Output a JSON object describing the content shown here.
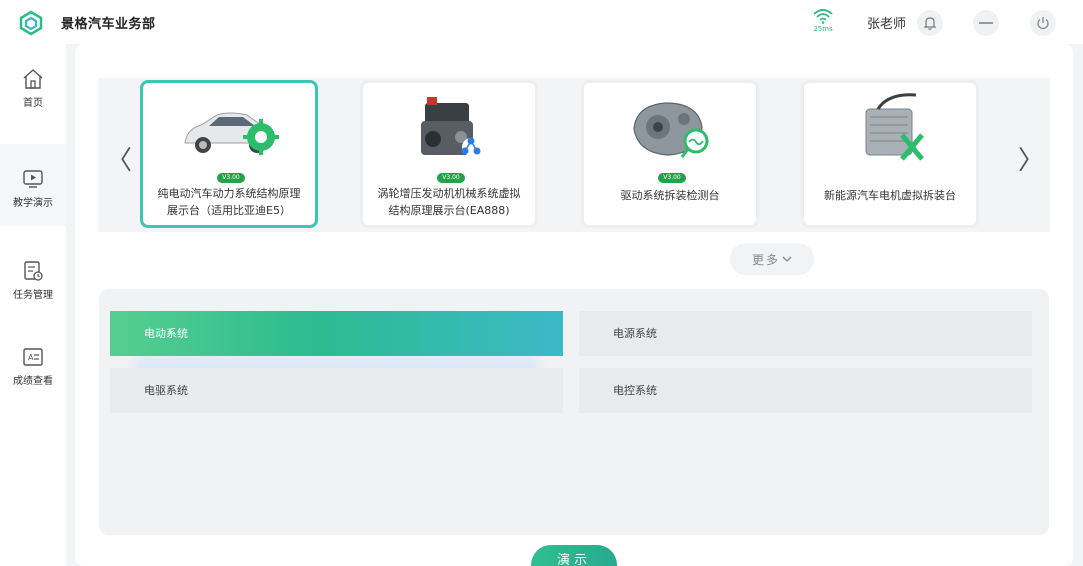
{
  "header": {
    "app_title": "景格汽车业务部",
    "latency": "25ms",
    "user_name": "张老师"
  },
  "icons": {
    "logo": "logo-icon",
    "wifi": "wifi-icon",
    "bell": "bell-icon",
    "more": "more-icon",
    "power": "power-icon"
  },
  "sidebar": {
    "items": [
      {
        "label": "首页",
        "icon": "home-icon"
      },
      {
        "label": "教学演示",
        "icon": "play-screen-icon"
      },
      {
        "label": "任务管理",
        "icon": "task-icon"
      },
      {
        "label": "成绩查看",
        "icon": "score-icon"
      }
    ]
  },
  "carousel": {
    "prev": "〈",
    "next": "〉",
    "cards": [
      {
        "version": "V3.00",
        "title": "纯电动汽车动力系统结构原理展示台（适用比亚迪E5）"
      },
      {
        "version": "V3.00",
        "title": "涡轮增压发动机机械系统虚拟结构原理展示台(EA888)"
      },
      {
        "version": "V3.00",
        "title": "驱动系统拆装检测台"
      },
      {
        "version": "",
        "title": "新能源汽车电机虚拟拆装台"
      }
    ]
  },
  "more_label": "更多",
  "systems": [
    {
      "label": "电动系统"
    },
    {
      "label": "电源系统"
    },
    {
      "label": "电驱系统"
    },
    {
      "label": "电控系统"
    }
  ],
  "demo_label": "演示",
  "colors": {
    "accent": "#2bbd84",
    "selected_border": "#3cc5b3",
    "version_badge": "#22a34a"
  }
}
